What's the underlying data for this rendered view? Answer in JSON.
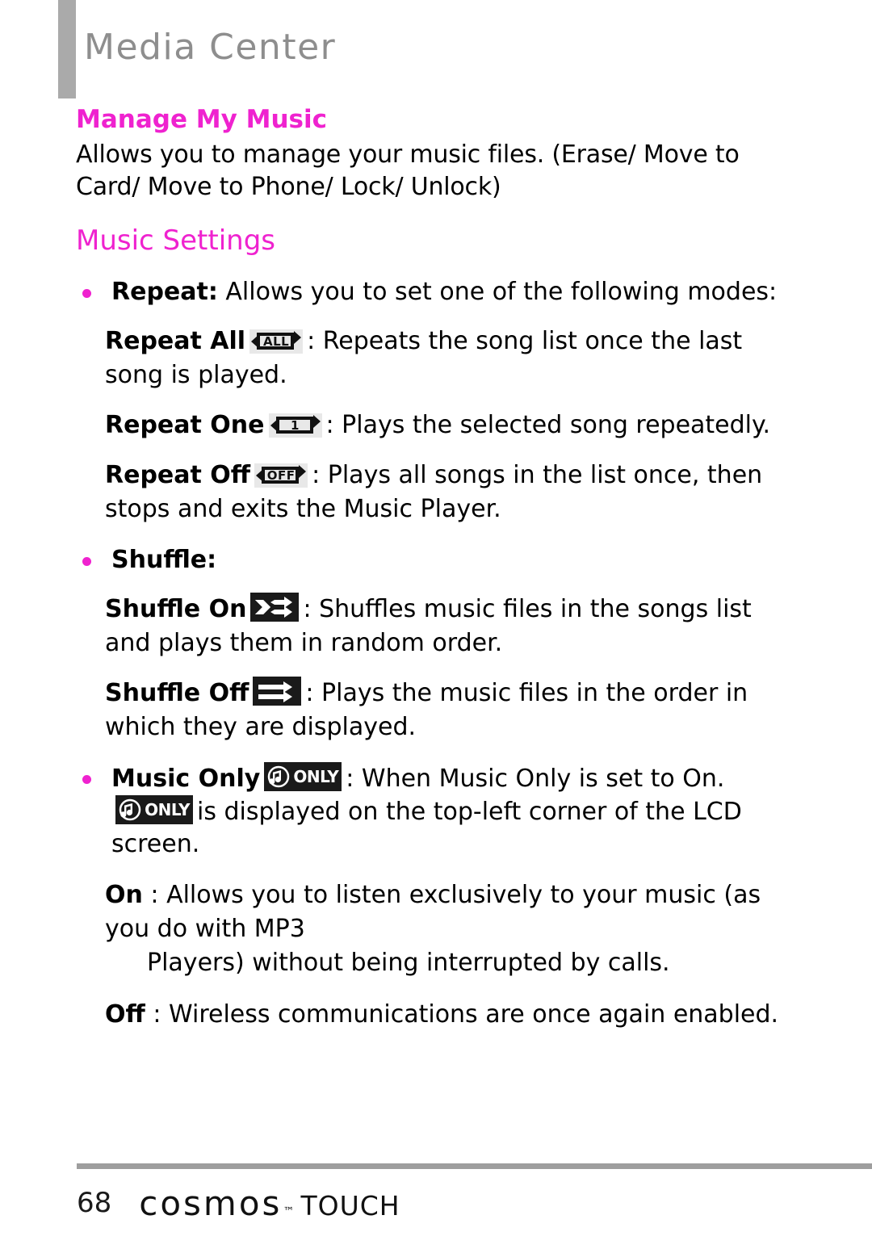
{
  "header": {
    "title": "Media Center",
    "accent_gray": "#aaaaaa",
    "title_color": "#8e8e8e"
  },
  "theme": {
    "accent_pink": "#ef22cf",
    "text_black": "#000000",
    "rule_gray": "#9e9e9e"
  },
  "sections": {
    "manage": {
      "heading": "Manage My Music",
      "body": "Allows you to manage your music files. (Erase/ Move to Card/ Move to Phone/ Lock/ Unlock)"
    },
    "music_settings": {
      "heading": "Music Settings"
    }
  },
  "repeat": {
    "bullet_label": "Repeat:",
    "bullet_text": " Allows you to set one of the following modes:",
    "items": [
      {
        "label": "Repeat All",
        "icon": "repeat-all-icon",
        "icon_text": "ALL",
        "desc": ": Repeats the song list once the last song is played."
      },
      {
        "label": "Repeat One",
        "icon": "repeat-one-icon",
        "icon_text": "1",
        "desc": ": Plays the selected song repeatedly."
      },
      {
        "label": "Repeat Off",
        "icon": "repeat-off-icon",
        "icon_text": "OFF",
        "desc": ": Plays all songs in the list once, then stops and exits the Music Player."
      }
    ]
  },
  "shuffle": {
    "bullet_label": "Shuffle:",
    "items": [
      {
        "label": "Shuffle On",
        "icon": "shuffle-on-icon",
        "desc": ": Shuffles music files in the songs list and plays them in random order."
      },
      {
        "label": "Shuffle Off",
        "icon": "shuffle-off-icon",
        "desc": ": Plays the music files in the order in which they are displayed."
      }
    ]
  },
  "music_only": {
    "label": "Music Only",
    "icon": "music-only-icon",
    "icon_text": "ONLY",
    "desc_part1": ": When Music Only is set to On.",
    "desc_part2": "is displayed on the top-left corner of the LCD screen.",
    "on": {
      "label": "On",
      "sep": " : ",
      "text": "Allows you to listen exclusively to your music (as you do with MP3",
      "text_cont": "Players) without being interrupted by calls."
    },
    "off": {
      "label": "Off",
      "sep": " : ",
      "text": "Wireless communications are once again enabled."
    }
  },
  "footer": {
    "page_number": "68",
    "brand": "cosmos",
    "tm": "™",
    "product": "TOUCH"
  }
}
